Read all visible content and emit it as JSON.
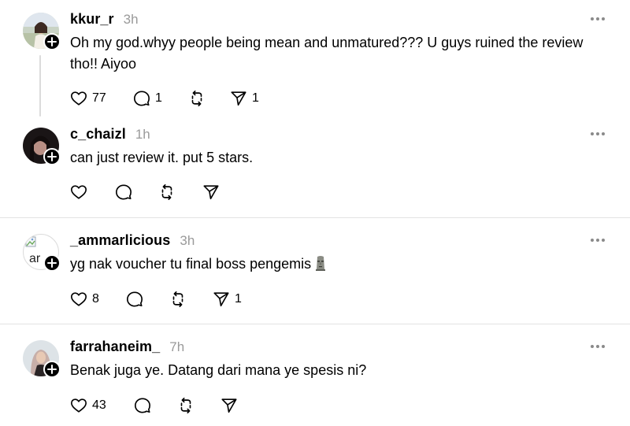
{
  "posts": [
    {
      "username": "kkur_r",
      "time": "3h",
      "text": "Oh my god.whyy people being mean and unmatured??? U guys ruined the review tho!! Aiyoo",
      "likes": "77",
      "replies": "1",
      "reposts": "",
      "shares": "1"
    },
    {
      "username": "c_chaizl",
      "time": "1h",
      "text": "can just review it. put 5 stars.",
      "likes": "",
      "replies": "",
      "reposts": "",
      "shares": ""
    },
    {
      "username": "_ammarlicious",
      "time": "3h",
      "text": "yg nak voucher tu final boss pengemis",
      "avatar_alt": "ar",
      "likes": "8",
      "replies": "",
      "reposts": "",
      "shares": "1"
    },
    {
      "username": "farrahaneim_",
      "time": "7h",
      "text": "Benak juga ye. Datang dari mana ye spesis ni?",
      "likes": "43",
      "replies": "",
      "reposts": "",
      "shares": ""
    }
  ],
  "icons": {
    "like": "heart-icon",
    "reply": "comment-icon",
    "repost": "repost-icon",
    "share": "send-icon",
    "more": "more-options-icon",
    "follow": "plus-icon"
  }
}
